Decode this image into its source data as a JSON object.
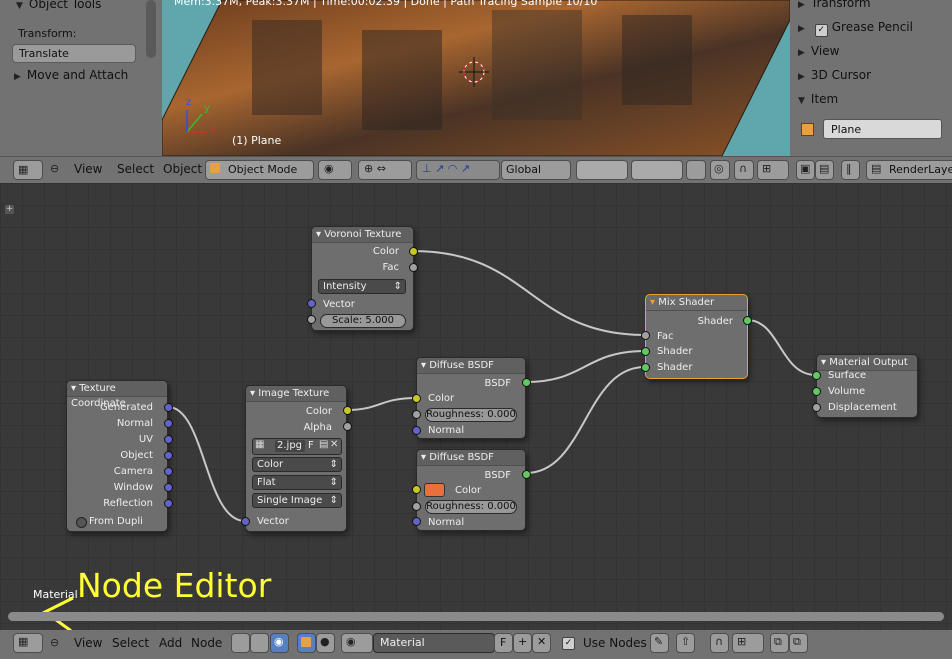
{
  "tool_shelf": {
    "object_tools_label": "Object Tools",
    "transform_label": "Transform:",
    "translate_button": "Translate",
    "move_attach_label": "Move and Attach"
  },
  "viewport": {
    "status_text": "Mem:3.37M, Peak:3.37M | Time:00:02.39 | Done | Path Tracing Sample 10/10",
    "object_label": "(1) Plane",
    "axis_x": "x",
    "axis_y": "y",
    "axis_z": "z"
  },
  "properties_panel": {
    "transform": "Transform",
    "grease_pencil": "Grease Pencil",
    "view": "View",
    "cursor_3d": "3D Cursor",
    "item": "Item",
    "item_name": "Plane"
  },
  "view3d_header": {
    "menus": [
      "View",
      "Select",
      "Object"
    ],
    "mode": "Object Mode",
    "orientation": "Global",
    "render_layer": "RenderLayer"
  },
  "node_editor": {
    "context_label": "Material",
    "annotation": "Node Editor",
    "nodes": {
      "voronoi": {
        "title": "Voronoi Texture",
        "color": "Color",
        "fac": "Fac",
        "coloring": "Intensity",
        "vector": "Vector",
        "scale": "Scale: 5.000"
      },
      "mix": {
        "title": "Mix Shader",
        "shader_out": "Shader",
        "fac": "Fac",
        "shader1": "Shader",
        "shader2": "Shader"
      },
      "output": {
        "title": "Material Output",
        "surface": "Surface",
        "volume": "Volume",
        "displacement": "Displacement"
      },
      "diffuse1": {
        "title": "Diffuse BSDF",
        "bsdf": "BSDF",
        "color": "Color",
        "roughness": "Roughness: 0.000",
        "normal": "Normal"
      },
      "diffuse2": {
        "title": "Diffuse BSDF",
        "bsdf": "BSDF",
        "color": "Color",
        "color_swatch": "#e8703a",
        "roughness": "Roughness: 0.000",
        "normal": "Normal"
      },
      "image": {
        "title": "Image Texture",
        "color": "Color",
        "alpha": "Alpha",
        "image_name": "2.jpg",
        "fake_user": "F",
        "color_space": "Color",
        "projection": "Flat",
        "source": "Single Image",
        "vector": "Vector"
      },
      "texcoord": {
        "title": "Texture Coordinate",
        "outputs": [
          "Generated",
          "Normal",
          "UV",
          "Object",
          "Camera",
          "Window",
          "Reflection"
        ],
        "from_dupli": "From Dupli"
      }
    }
  },
  "node_header": {
    "menus": [
      "View",
      "Select",
      "Add",
      "Node"
    ],
    "material_name": "Material",
    "fake_user": "F",
    "use_nodes": "Use Nodes"
  },
  "colors": {
    "annotation": "#ffff33",
    "viewport_bg": "#5fa7ad",
    "mix_shader_outline": "#f0a030"
  }
}
